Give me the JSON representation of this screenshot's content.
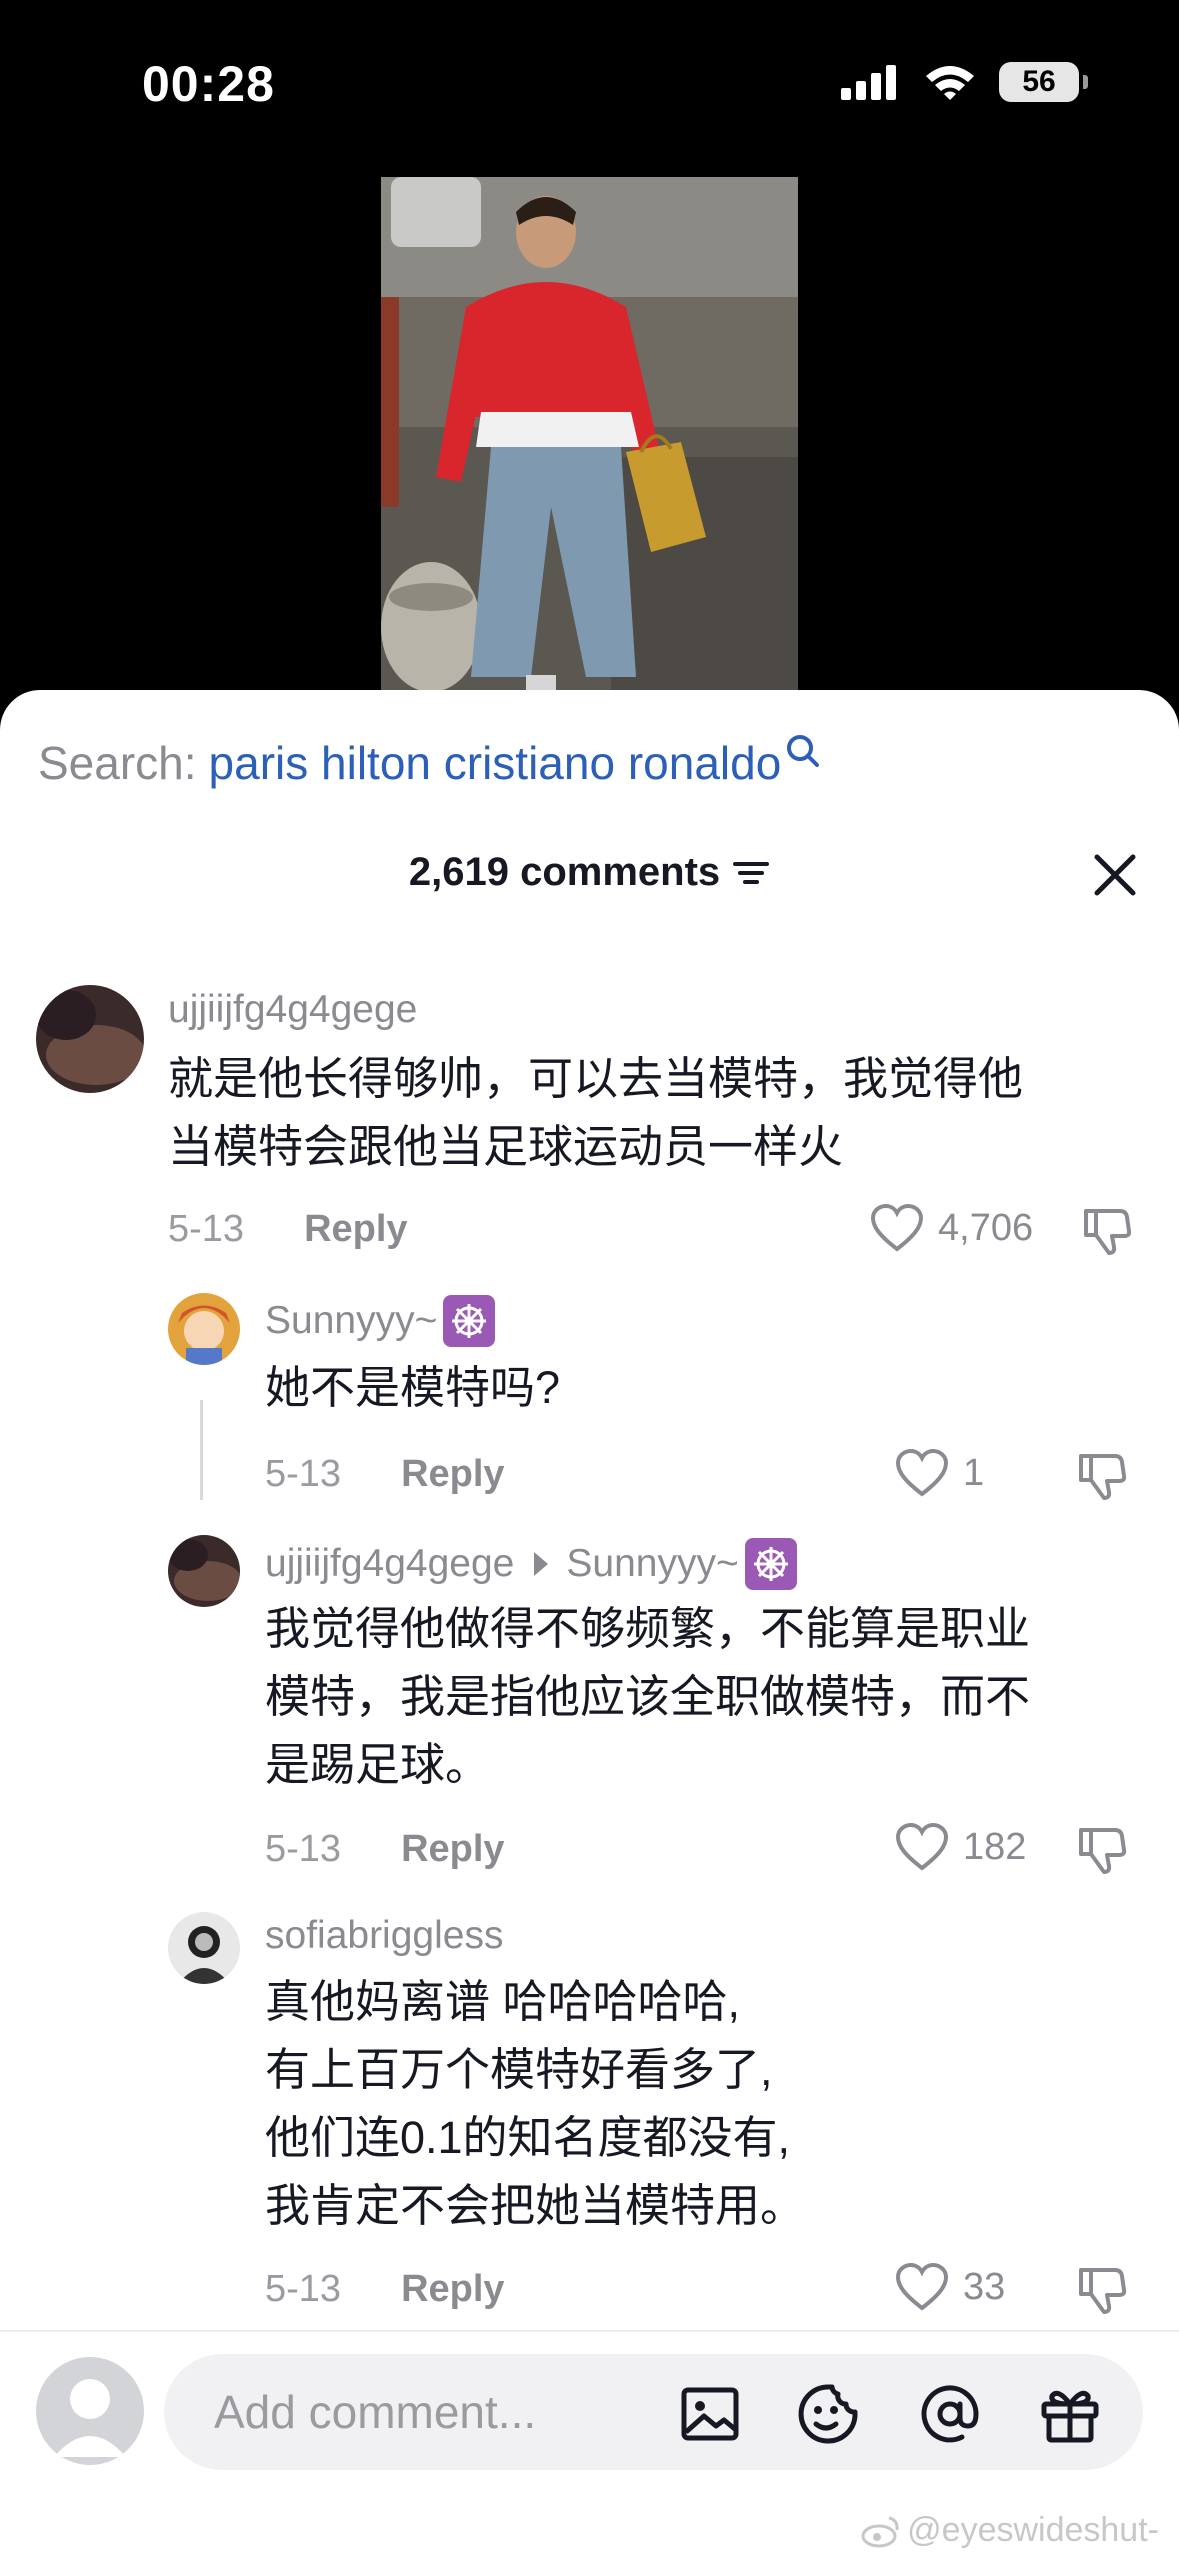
{
  "status_bar": {
    "time": "00:28",
    "battery": "56"
  },
  "search": {
    "prefix": "Search:",
    "term": "paris hilton cristiano ronaldo"
  },
  "header": {
    "comment_count": "2,619 comments"
  },
  "comments": [
    {
      "username": "ujjiijfg4g4gege",
      "text_lines": [
        "就是他长得够帅，可以去当模特，我觉得他",
        "当模特会跟他当足球运动员一样火"
      ],
      "date": "5-13",
      "reply": "Reply",
      "likes": "4,706"
    },
    {
      "username": "Sunnyyy~",
      "text_lines": [
        "她不是模特吗?"
      ],
      "date": "5-13",
      "reply": "Reply",
      "likes": "1"
    },
    {
      "username": "ujjiijfg4g4gege",
      "reply_to": "Sunnyyy~",
      "text_lines": [
        "我觉得他做得不够频繁，不能算是职业",
        "模特，我是指他应该全职做模特，而不",
        "是踢足球。"
      ],
      "date": "5-13",
      "reply": "Reply",
      "likes": "182"
    },
    {
      "username": "sofiabriggless",
      "text_lines": [
        "真他妈离谱 哈哈哈哈哈,",
        "有上百万个模特好看多了,",
        "他们连0.1的知名度都没有,",
        "我肯定不会把她当模特用。"
      ],
      "date": "5-13",
      "reply": "Reply",
      "likes": "33"
    }
  ],
  "composer": {
    "placeholder": "Add comment..."
  },
  "watermark": "@eyeswideshut-",
  "colors": {
    "link_blue": "#2b5fb8",
    "muted_gray": "#8a8b91",
    "text_dark": "#161823"
  }
}
